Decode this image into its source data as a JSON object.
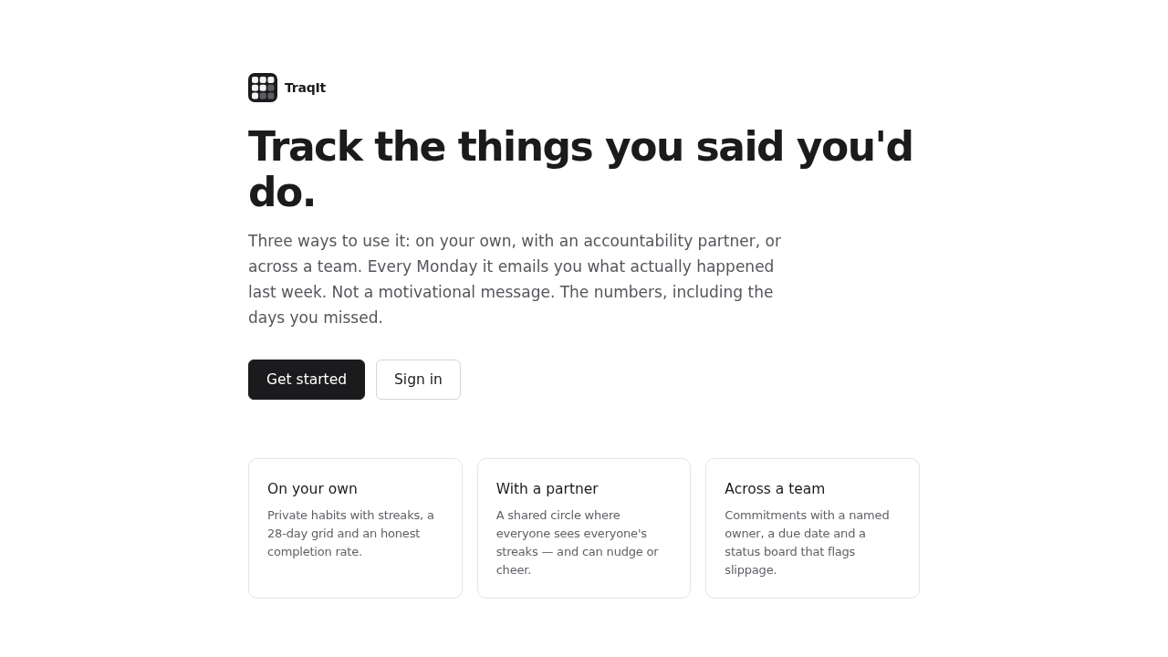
{
  "brand": {
    "name": "TraqIt"
  },
  "hero": {
    "title": "Track the things you said you'd do.",
    "description": "Three ways to use it: on your own, with an accountability partner, or across a team. Every Monday it emails you what actually happened last week. Not a motivational message. The numbers, including the days you missed."
  },
  "actions": [
    {
      "label": "Get started",
      "kind": "primary"
    },
    {
      "label": "Sign in",
      "kind": "secondary"
    }
  ],
  "cards": [
    {
      "title": "On your own",
      "description": "Private habits with streaks, a 28-day grid and an honest completion rate."
    },
    {
      "title": "With a partner",
      "description": "A shared circle where everyone sees everyone's streaks — and can nudge or cheer."
    },
    {
      "title": "Across a team",
      "description": "Commitments with a named owner, a due date and a status board that flags slippage."
    }
  ]
}
